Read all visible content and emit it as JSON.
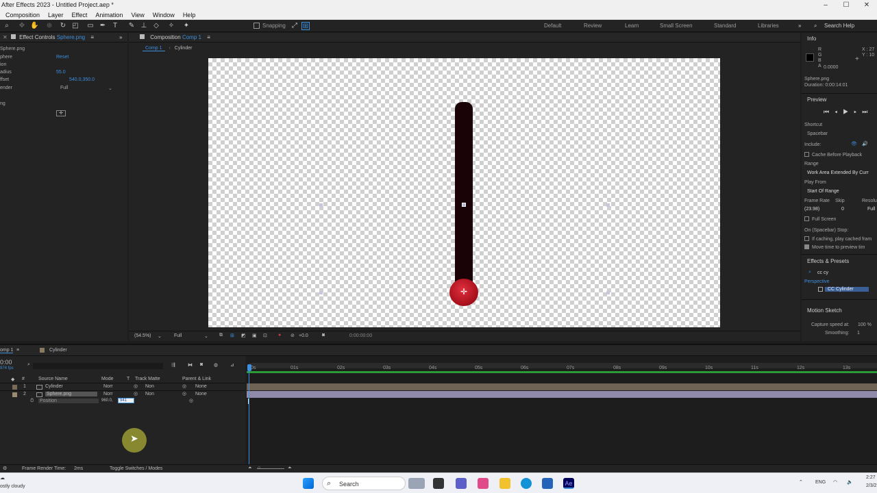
{
  "window": {
    "title": "After Effects 2023 - Untitled Project.aep *",
    "controls": [
      "–",
      "☐",
      "✕"
    ]
  },
  "menu": [
    "Composition",
    "Layer",
    "Effect",
    "Animation",
    "View",
    "Window",
    "Help"
  ],
  "toolbar": {
    "snapping_label": "Snapping",
    "workspaces": [
      "Default",
      "Review",
      "Learn",
      "Small Screen",
      "Standard",
      "Libraries"
    ],
    "overflow": "»",
    "search_help": "Search Help"
  },
  "effect_controls": {
    "tab_label": "Effect Controls",
    "tab_layer": "Sphere.png",
    "layer_label": "Sphere.png",
    "props": [
      {
        "label": "phere",
        "value": "Reset"
      },
      {
        "label": "ion",
        "value": ""
      },
      {
        "label": "adius",
        "value": "55.0"
      },
      {
        "label": "ffset",
        "value": "540.0,350.0"
      },
      {
        "label": "ender",
        "value": "Full"
      },
      {
        "label": "ng",
        "value": ""
      }
    ]
  },
  "composition_panel": {
    "tab_label": "Composition",
    "tab_name": "Comp 1",
    "breadcrumbs": [
      "Comp 1",
      "Cylinder"
    ],
    "zoom": "(54.5%)",
    "resolution": "Full",
    "exposure": "+0.0",
    "timecode": "0:00:00:00"
  },
  "info": {
    "title": "Info",
    "channels": [
      "R",
      "G",
      "B",
      "A"
    ],
    "alpha": "0.0000",
    "x_label": "X : 27",
    "y_label": "Y : 10",
    "layer": "Sphere.png",
    "duration": "Duration: 0:00:14:01"
  },
  "preview": {
    "title": "Preview",
    "shortcut_label": "Shortcut",
    "shortcut": "Spacebar",
    "include_label": "Include:",
    "cache_label": "Cache Before Playback",
    "range_label": "Range",
    "range": "Work Area Extended By Curr",
    "play_from_label": "Play From",
    "play_from": "Start Of Range",
    "frame_rate_label": "Frame Rate",
    "skip_label": "Skip",
    "resolution_label": "Resolu",
    "frame_rate": "(23.98)",
    "skip": "0",
    "resolution": "Full",
    "full_screen_label": "Full Screen",
    "on_stop_label": "On (Spacebar) Stop:",
    "cached_label": "If caching, play cached fram",
    "move_time_label": "Move time to preview tim"
  },
  "effects_presets": {
    "title": "Effects & Presets",
    "search": "cc cy",
    "category": "Perspective",
    "item": "CC Cylinder"
  },
  "motion_sketch": {
    "title": "Motion Sketch",
    "capture_label": "Capture speed at:",
    "capture_value": "100 %",
    "smoothing_label": "Smoothing:",
    "smoothing_value": "1"
  },
  "timeline": {
    "tab_label": "omp 1",
    "tab2_label": "Cylinder",
    "timecode": "0:00",
    "fps": "974 fps",
    "columns": {
      "source": "Source Name",
      "mode": "Mode",
      "t": "T",
      "track_matte": "Track Matte",
      "parent": "Parent & Link"
    },
    "layers": [
      {
        "num": "1",
        "name": "Cylinder",
        "mode": "Norr",
        "matte": "Non",
        "parent": "None"
      },
      {
        "num": "2",
        "name": "Sphere.png",
        "mode": "Norr",
        "matte": "Non",
        "parent": "None"
      }
    ],
    "position_label": "Position",
    "position_x": "960.0,",
    "position_y": "941",
    "ticks": [
      "0s",
      "01s",
      "02s",
      "03s",
      "04s",
      "05s",
      "06s",
      "07s",
      "08s",
      "09s",
      "10s",
      "11s",
      "12s",
      "13s"
    ],
    "render_time_label": "Frame Render Time:",
    "render_time": "2ms",
    "toggle_label": "Toggle Switches / Modes"
  },
  "taskbar": {
    "weather": "ostly cloudy",
    "search_placeholder": "Search",
    "language": "ENG",
    "time": "2:27",
    "date": "2/3/2"
  },
  "colors": {
    "accent": "#3d8fe0",
    "rod": "#1a0306",
    "sphere": "#c01a2a",
    "layer1_bar": "#6f6355",
    "layer2_bar": "#8e8aa8"
  }
}
